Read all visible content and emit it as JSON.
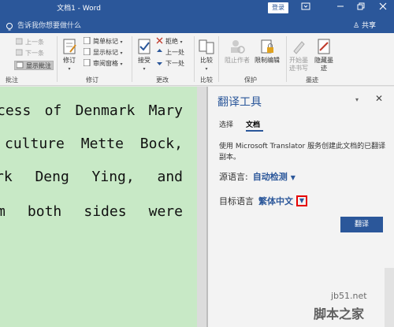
{
  "window": {
    "title": "文档1 - Word",
    "login_label": "登录",
    "icons": [
      "ribbon-display-icon",
      "minimize-icon",
      "restore-icon",
      "close-icon"
    ]
  },
  "tellme": {
    "text": "告诉我你想要做什么",
    "share_label": "共享"
  },
  "ribbon": {
    "groups": {
      "comments": {
        "label": "批注",
        "prev": "上一条",
        "next": "下一条",
        "show": "显示批注"
      },
      "tracking": {
        "label": "修订",
        "track_label": "修订",
        "simple_markup": "简单标记",
        "show_markup": "显示标记",
        "review_pane": "审阅窗格"
      },
      "changes": {
        "label": "更改",
        "accept": "接受",
        "reject": "拒绝",
        "prev": "上一处",
        "next": "下一处"
      },
      "compare": {
        "label": "比较",
        "compare_btn": "比较"
      },
      "protect": {
        "label": "保护",
        "block_authors": "阻止作者",
        "restrict_editing": "限制编辑"
      },
      "ink": {
        "label": "墨迹",
        "start_inking": "开始墨迹书写",
        "hide_ink": "隐藏墨迹"
      }
    }
  },
  "document": {
    "lines": [
      [
        "cess",
        "of",
        "Denmark",
        "Mary"
      ],
      [
        "culture",
        "Mette",
        "Bock,"
      ],
      [
        "rk",
        "Deng",
        "Ying,",
        "and"
      ],
      [
        "m",
        "both",
        "sides",
        "were"
      ]
    ]
  },
  "translator": {
    "title": "翻译工具",
    "tabs": [
      "选择",
      "文档"
    ],
    "active_tab": "文档",
    "description": "使用 Microsoft Translator 服务创建此文档的已翻译副本。",
    "source_label": "源语言:",
    "source_value": "自动检测",
    "target_label": "目标语言",
    "target_value": "繁体中文",
    "translate_button": "翻译"
  },
  "watermark": {
    "site": "jb51.net",
    "name": "脚本之家"
  },
  "colors": {
    "accent": "#2b579a",
    "document_bg": "#c8e9c6",
    "highlight_box": "#e60000"
  }
}
